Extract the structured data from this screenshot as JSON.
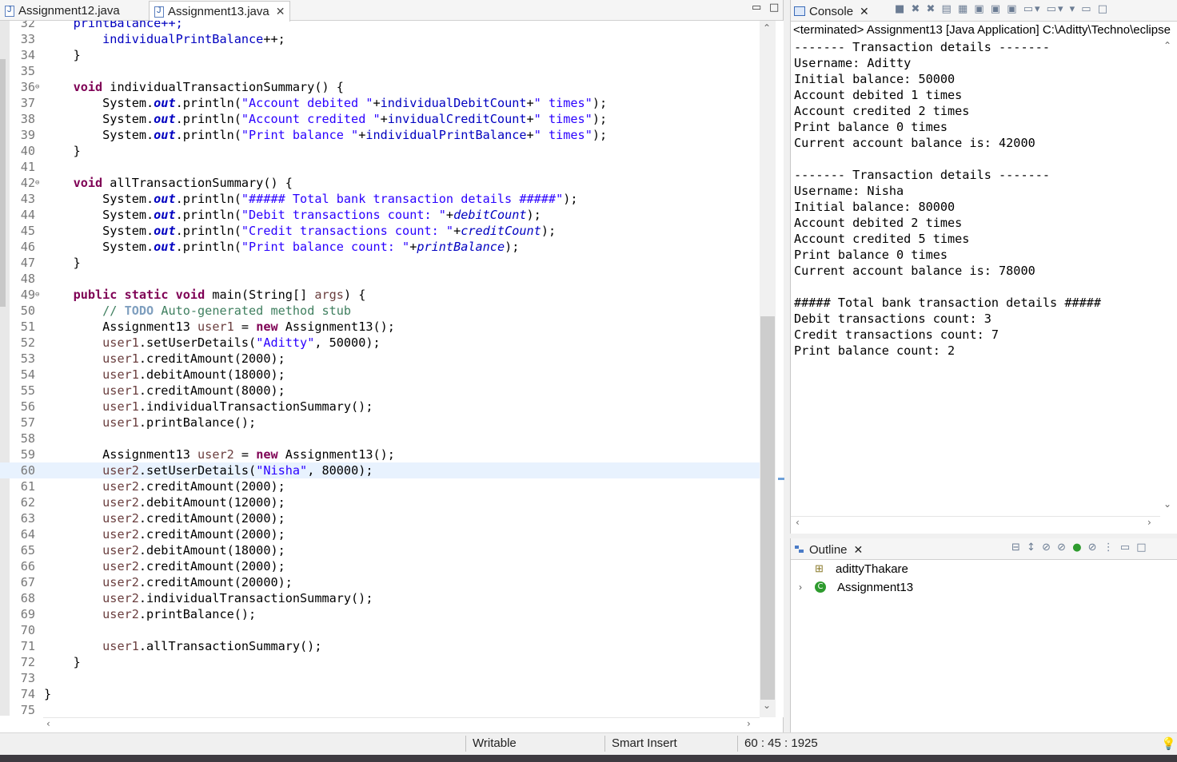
{
  "editor": {
    "tabs": [
      {
        "label": "Assignment12.java",
        "active": false
      },
      {
        "label": "Assignment13.java",
        "active": true
      }
    ],
    "cursor_line": 60,
    "lines": [
      {
        "n": "32",
        "tokens": [
          [
            "    printBalance++;",
            "fld"
          ]
        ]
      },
      {
        "n": "33",
        "tokens": [
          [
            "        ",
            ""
          ],
          [
            "individualPrintBalance",
            "fld"
          ],
          [
            "++;",
            ""
          ]
        ]
      },
      {
        "n": "34",
        "tokens": [
          [
            "    }",
            ""
          ]
        ]
      },
      {
        "n": "35",
        "tokens": []
      },
      {
        "n": "36",
        "fold": true,
        "tokens": [
          [
            "    ",
            ""
          ],
          [
            "void",
            "kw"
          ],
          [
            " individualTransactionSummary() {",
            ""
          ]
        ]
      },
      {
        "n": "37",
        "tokens": [
          [
            "        System.",
            ""
          ],
          [
            "out",
            "sfld"
          ],
          [
            ".println(",
            ""
          ],
          [
            "\"Account debited \"",
            "str"
          ],
          [
            "+",
            ""
          ],
          [
            "individualDebitCount",
            "fld"
          ],
          [
            "+",
            ""
          ],
          [
            "\" times\"",
            "str"
          ],
          [
            ");",
            ""
          ]
        ]
      },
      {
        "n": "38",
        "tokens": [
          [
            "        System.",
            ""
          ],
          [
            "out",
            "sfld"
          ],
          [
            ".println(",
            ""
          ],
          [
            "\"Account credited \"",
            "str"
          ],
          [
            "+",
            ""
          ],
          [
            "invidualCreditCount",
            "fld"
          ],
          [
            "+",
            ""
          ],
          [
            "\" times\"",
            "str"
          ],
          [
            ");",
            ""
          ]
        ]
      },
      {
        "n": "39",
        "tokens": [
          [
            "        System.",
            ""
          ],
          [
            "out",
            "sfld"
          ],
          [
            ".println(",
            ""
          ],
          [
            "\"Print balance \"",
            "str"
          ],
          [
            "+",
            ""
          ],
          [
            "individualPrintBalance",
            "fld"
          ],
          [
            "+",
            ""
          ],
          [
            "\" times\"",
            "str"
          ],
          [
            ");",
            ""
          ]
        ]
      },
      {
        "n": "40",
        "tokens": [
          [
            "    }",
            ""
          ]
        ]
      },
      {
        "n": "41",
        "tokens": []
      },
      {
        "n": "42",
        "fold": true,
        "tokens": [
          [
            "    ",
            ""
          ],
          [
            "void",
            "kw"
          ],
          [
            " allTransactionSummary() {",
            ""
          ]
        ]
      },
      {
        "n": "43",
        "tokens": [
          [
            "        System.",
            ""
          ],
          [
            "out",
            "sfld"
          ],
          [
            ".println(",
            ""
          ],
          [
            "\"##### Total bank transaction details #####\"",
            "str"
          ],
          [
            ");",
            ""
          ]
        ]
      },
      {
        "n": "44",
        "tokens": [
          [
            "        System.",
            ""
          ],
          [
            "out",
            "sfld"
          ],
          [
            ".println(",
            ""
          ],
          [
            "\"Debit transactions count: \"",
            "str"
          ],
          [
            "+",
            ""
          ],
          [
            "debitCount",
            "ifld"
          ],
          [
            ");",
            ""
          ]
        ]
      },
      {
        "n": "45",
        "tokens": [
          [
            "        System.",
            ""
          ],
          [
            "out",
            "sfld"
          ],
          [
            ".println(",
            ""
          ],
          [
            "\"Credit transactions count: \"",
            "str"
          ],
          [
            "+",
            ""
          ],
          [
            "creditCount",
            "ifld"
          ],
          [
            ");",
            ""
          ]
        ]
      },
      {
        "n": "46",
        "tokens": [
          [
            "        System.",
            ""
          ],
          [
            "out",
            "sfld"
          ],
          [
            ".println(",
            ""
          ],
          [
            "\"Print balance count: \"",
            "str"
          ],
          [
            "+",
            ""
          ],
          [
            "printBalance",
            "ifld"
          ],
          [
            ");",
            ""
          ]
        ]
      },
      {
        "n": "47",
        "tokens": [
          [
            "    }",
            ""
          ]
        ]
      },
      {
        "n": "48",
        "tokens": []
      },
      {
        "n": "49",
        "fold": true,
        "tokens": [
          [
            "    ",
            ""
          ],
          [
            "public",
            "kw"
          ],
          [
            " ",
            ""
          ],
          [
            "static",
            "kw"
          ],
          [
            " ",
            ""
          ],
          [
            "void",
            "kw"
          ],
          [
            " main(String[] ",
            ""
          ],
          [
            "args",
            "var"
          ],
          [
            ") {",
            ""
          ]
        ]
      },
      {
        "n": "50",
        "tokens": [
          [
            "        ",
            ""
          ],
          [
            "// ",
            "cmt"
          ],
          [
            "TODO",
            "todo"
          ],
          [
            " Auto-generated method stub",
            "cmt"
          ]
        ]
      },
      {
        "n": "51",
        "tokens": [
          [
            "        Assignment13 ",
            ""
          ],
          [
            "user1",
            "var"
          ],
          [
            " = ",
            ""
          ],
          [
            "new",
            "kw"
          ],
          [
            " Assignment13();",
            ""
          ]
        ]
      },
      {
        "n": "52",
        "tokens": [
          [
            "        ",
            ""
          ],
          [
            "user1",
            "var"
          ],
          [
            ".setUserDetails(",
            ""
          ],
          [
            "\"Aditty\"",
            "str"
          ],
          [
            ", 50000);",
            ""
          ]
        ]
      },
      {
        "n": "53",
        "tokens": [
          [
            "        ",
            ""
          ],
          [
            "user1",
            "var"
          ],
          [
            ".creditAmount(2000);",
            ""
          ]
        ]
      },
      {
        "n": "54",
        "tokens": [
          [
            "        ",
            ""
          ],
          [
            "user1",
            "var"
          ],
          [
            ".debitAmount(18000);",
            ""
          ]
        ]
      },
      {
        "n": "55",
        "tokens": [
          [
            "        ",
            ""
          ],
          [
            "user1",
            "var"
          ],
          [
            ".creditAmount(8000);",
            ""
          ]
        ]
      },
      {
        "n": "56",
        "tokens": [
          [
            "        ",
            ""
          ],
          [
            "user1",
            "var"
          ],
          [
            ".individualTransactionSummary();",
            ""
          ]
        ]
      },
      {
        "n": "57",
        "tokens": [
          [
            "        ",
            ""
          ],
          [
            "user1",
            "var"
          ],
          [
            ".printBalance();",
            ""
          ]
        ]
      },
      {
        "n": "58",
        "tokens": []
      },
      {
        "n": "59",
        "tokens": [
          [
            "        Assignment13 ",
            ""
          ],
          [
            "user2",
            "var"
          ],
          [
            " = ",
            ""
          ],
          [
            "new",
            "kw"
          ],
          [
            " Assignment13();",
            ""
          ]
        ]
      },
      {
        "n": "60",
        "tokens": [
          [
            "        ",
            ""
          ],
          [
            "user2",
            "var"
          ],
          [
            ".setUserDetails(",
            ""
          ],
          [
            "\"Nisha\"",
            "str"
          ],
          [
            ", 80000);",
            ""
          ]
        ]
      },
      {
        "n": "61",
        "tokens": [
          [
            "        ",
            ""
          ],
          [
            "user2",
            "var"
          ],
          [
            ".creditAmount(2000);",
            ""
          ]
        ]
      },
      {
        "n": "62",
        "tokens": [
          [
            "        ",
            ""
          ],
          [
            "user2",
            "var"
          ],
          [
            ".debitAmount(12000);",
            ""
          ]
        ]
      },
      {
        "n": "63",
        "tokens": [
          [
            "        ",
            ""
          ],
          [
            "user2",
            "var"
          ],
          [
            ".creditAmount(2000);",
            ""
          ]
        ]
      },
      {
        "n": "64",
        "tokens": [
          [
            "        ",
            ""
          ],
          [
            "user2",
            "var"
          ],
          [
            ".creditAmount(2000);",
            ""
          ]
        ]
      },
      {
        "n": "65",
        "tokens": [
          [
            "        ",
            ""
          ],
          [
            "user2",
            "var"
          ],
          [
            ".debitAmount(18000);",
            ""
          ]
        ]
      },
      {
        "n": "66",
        "tokens": [
          [
            "        ",
            ""
          ],
          [
            "user2",
            "var"
          ],
          [
            ".creditAmount(2000);",
            ""
          ]
        ]
      },
      {
        "n": "67",
        "tokens": [
          [
            "        ",
            ""
          ],
          [
            "user2",
            "var"
          ],
          [
            ".creditAmount(20000);",
            ""
          ]
        ]
      },
      {
        "n": "68",
        "tokens": [
          [
            "        ",
            ""
          ],
          [
            "user2",
            "var"
          ],
          [
            ".individualTransactionSummary();",
            ""
          ]
        ]
      },
      {
        "n": "69",
        "tokens": [
          [
            "        ",
            ""
          ],
          [
            "user2",
            "var"
          ],
          [
            ".printBalance();",
            ""
          ]
        ]
      },
      {
        "n": "70",
        "tokens": []
      },
      {
        "n": "71",
        "tokens": [
          [
            "        ",
            ""
          ],
          [
            "user1",
            "var"
          ],
          [
            ".allTransactionSummary();",
            ""
          ]
        ]
      },
      {
        "n": "72",
        "tokens": [
          [
            "    }",
            ""
          ]
        ]
      },
      {
        "n": "73",
        "tokens": []
      },
      {
        "n": "74",
        "tokens": [
          [
            "}",
            ""
          ]
        ]
      },
      {
        "n": "75",
        "tokens": []
      }
    ]
  },
  "console": {
    "tab_label": "Console",
    "status": "<terminated> Assignment13 [Java Application] C:\\Aditty\\Techno\\eclipse",
    "output": [
      "------- Transaction details -------",
      "Username: Aditty",
      "Initial balance: 50000",
      "Account debited 1 times",
      "Account credited 2 times",
      "Print balance 0 times",
      "Current account balance is: 42000",
      "",
      "------- Transaction details -------",
      "Username: Nisha",
      "Initial balance: 80000",
      "Account debited 2 times",
      "Account credited 5 times",
      "Print balance 0 times",
      "Current account balance is: 78000",
      "",
      "##### Total bank transaction details #####",
      "Debit transactions count: 3",
      "Credit transactions count: 7",
      "Print balance count: 2"
    ]
  },
  "outline": {
    "tab_label": "Outline",
    "items": [
      {
        "label": "adittyThakare",
        "icon": "package-icon"
      },
      {
        "label": "Assignment13",
        "icon": "class-icon"
      }
    ]
  },
  "statusbar": {
    "writable": "Writable",
    "insert_mode": "Smart Insert",
    "position": "60 : 45 : 1925"
  },
  "colors": {
    "keyword": "#7f0055",
    "string": "#2a00ff",
    "field": "#0000c0",
    "comment": "#3f7f5f",
    "current_line": "#e8f2fe"
  }
}
